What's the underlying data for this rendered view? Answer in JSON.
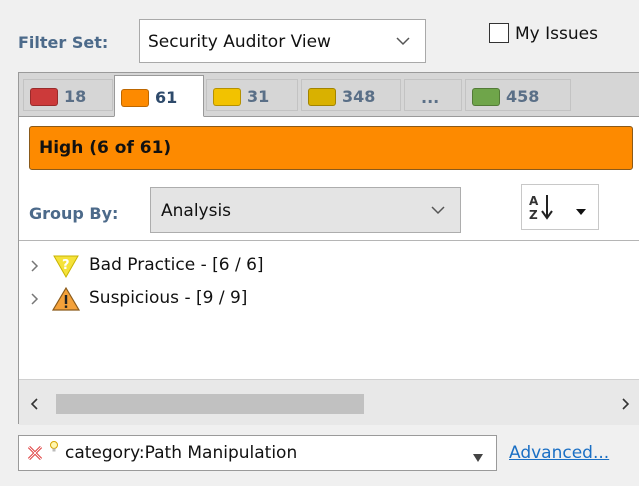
{
  "filter": {
    "label": "Filter Set:",
    "selected": "Security Auditor View",
    "my_issues_label": "My Issues",
    "my_issues_checked": false
  },
  "tabs": [
    {
      "count": "18",
      "color": "#cc3a3a",
      "active": false
    },
    {
      "count": "61",
      "color": "#fd8a00",
      "active": true
    },
    {
      "count": "31",
      "color": "#f2c200",
      "active": false
    },
    {
      "count": "348",
      "color": "#d9b100",
      "active": false
    },
    {
      "count": "...",
      "color": "",
      "active": false
    },
    {
      "count": "458",
      "color": "#6fa54a",
      "active": false
    }
  ],
  "priority": {
    "title": "High (6 of 61)",
    "color": "#fd8a00"
  },
  "group_by": {
    "label": "Group By:",
    "selected": "Analysis"
  },
  "tree": [
    {
      "label": "Bad Practice - [6 / 6]",
      "icon": "bad-practice-icon"
    },
    {
      "label": "Suspicious - [9 / 9]",
      "icon": "warning-icon"
    }
  ],
  "search": {
    "value": "category:Path Manipulation",
    "advanced_label": "Advanced..."
  }
}
